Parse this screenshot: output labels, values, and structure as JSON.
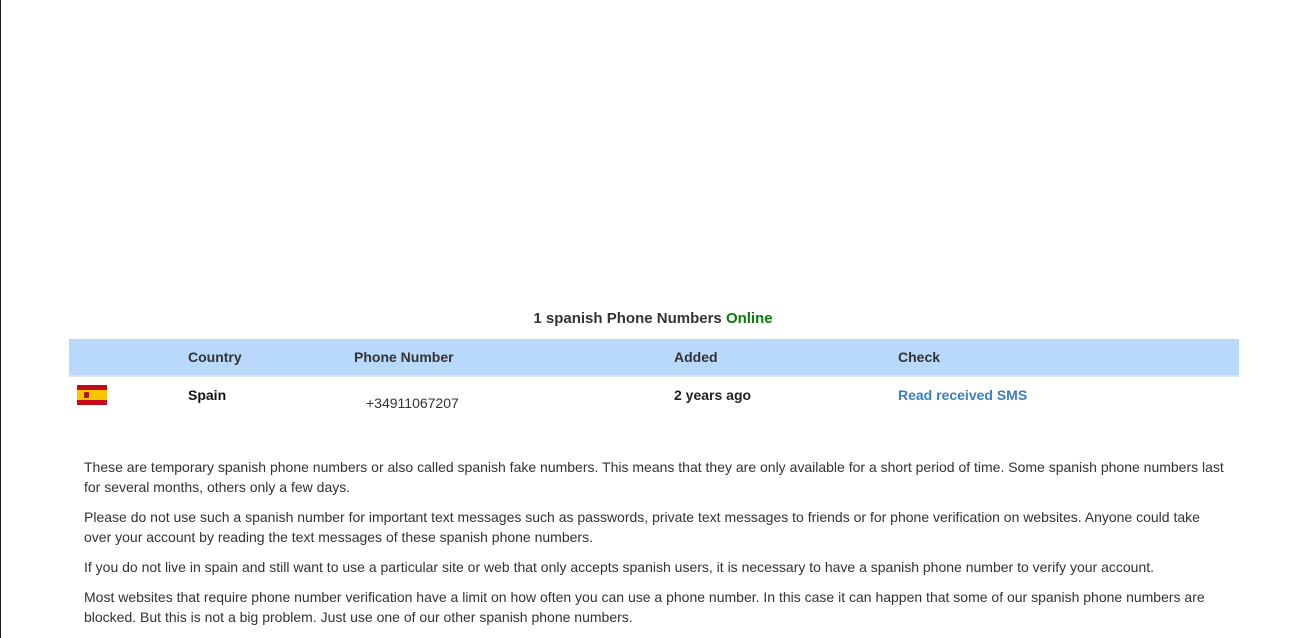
{
  "heading": {
    "prefix": "1 spanish Phone Numbers",
    "status": "Online"
  },
  "table": {
    "headers": {
      "country": "Country",
      "phone": "Phone Number",
      "added": "Added",
      "check": "Check"
    },
    "rows": [
      {
        "flag_icon": "spain-flag-icon",
        "country": "Spain",
        "phone": "+34911067207",
        "added": "2 years ago",
        "check": "Read received SMS"
      }
    ]
  },
  "paragraphs": [
    "These are temporary spanish phone numbers or also called spanish fake numbers. This means that they are only available for a short period of time. Some spanish phone numbers last for several months, others only a few days.",
    "Please do not use such a spanish number for important text messages such as passwords, private text messages to friends or for phone verification on websites. Anyone could take over your account by reading the text messages of these spanish phone numbers.",
    "If you do not live in spain and still want to use a particular site or web that only accepts spanish users, it is necessary to have a spanish phone number to verify your account.",
    "Most websites that require phone number verification have a limit on how often you can use a phone number. In this case it can happen that some of our spanish phone numbers are blocked. But this is not a big problem. Just use one of our other spanish phone numbers."
  ],
  "colors": {
    "header_bg": "#b8d9fa",
    "online": "#0a7a0a",
    "link": "#3a7ec2"
  }
}
